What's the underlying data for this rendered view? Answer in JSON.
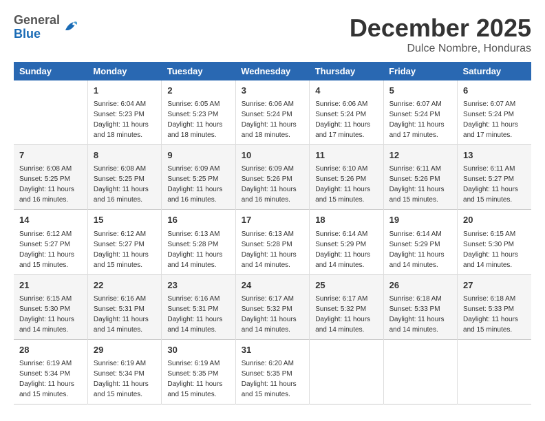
{
  "header": {
    "logo": {
      "general": "General",
      "blue": "Blue"
    },
    "title": "December 2025",
    "location": "Dulce Nombre, Honduras"
  },
  "days_of_week": [
    "Sunday",
    "Monday",
    "Tuesday",
    "Wednesday",
    "Thursday",
    "Friday",
    "Saturday"
  ],
  "weeks": [
    [
      {
        "day": "",
        "info": ""
      },
      {
        "day": "1",
        "info": "Sunrise: 6:04 AM\nSunset: 5:23 PM\nDaylight: 11 hours\nand 18 minutes."
      },
      {
        "day": "2",
        "info": "Sunrise: 6:05 AM\nSunset: 5:23 PM\nDaylight: 11 hours\nand 18 minutes."
      },
      {
        "day": "3",
        "info": "Sunrise: 6:06 AM\nSunset: 5:24 PM\nDaylight: 11 hours\nand 18 minutes."
      },
      {
        "day": "4",
        "info": "Sunrise: 6:06 AM\nSunset: 5:24 PM\nDaylight: 11 hours\nand 17 minutes."
      },
      {
        "day": "5",
        "info": "Sunrise: 6:07 AM\nSunset: 5:24 PM\nDaylight: 11 hours\nand 17 minutes."
      },
      {
        "day": "6",
        "info": "Sunrise: 6:07 AM\nSunset: 5:24 PM\nDaylight: 11 hours\nand 17 minutes."
      }
    ],
    [
      {
        "day": "7",
        "info": "Sunrise: 6:08 AM\nSunset: 5:25 PM\nDaylight: 11 hours\nand 16 minutes."
      },
      {
        "day": "8",
        "info": "Sunrise: 6:08 AM\nSunset: 5:25 PM\nDaylight: 11 hours\nand 16 minutes."
      },
      {
        "day": "9",
        "info": "Sunrise: 6:09 AM\nSunset: 5:25 PM\nDaylight: 11 hours\nand 16 minutes."
      },
      {
        "day": "10",
        "info": "Sunrise: 6:09 AM\nSunset: 5:26 PM\nDaylight: 11 hours\nand 16 minutes."
      },
      {
        "day": "11",
        "info": "Sunrise: 6:10 AM\nSunset: 5:26 PM\nDaylight: 11 hours\nand 15 minutes."
      },
      {
        "day": "12",
        "info": "Sunrise: 6:11 AM\nSunset: 5:26 PM\nDaylight: 11 hours\nand 15 minutes."
      },
      {
        "day": "13",
        "info": "Sunrise: 6:11 AM\nSunset: 5:27 PM\nDaylight: 11 hours\nand 15 minutes."
      }
    ],
    [
      {
        "day": "14",
        "info": "Sunrise: 6:12 AM\nSunset: 5:27 PM\nDaylight: 11 hours\nand 15 minutes."
      },
      {
        "day": "15",
        "info": "Sunrise: 6:12 AM\nSunset: 5:27 PM\nDaylight: 11 hours\nand 15 minutes."
      },
      {
        "day": "16",
        "info": "Sunrise: 6:13 AM\nSunset: 5:28 PM\nDaylight: 11 hours\nand 14 minutes."
      },
      {
        "day": "17",
        "info": "Sunrise: 6:13 AM\nSunset: 5:28 PM\nDaylight: 11 hours\nand 14 minutes."
      },
      {
        "day": "18",
        "info": "Sunrise: 6:14 AM\nSunset: 5:29 PM\nDaylight: 11 hours\nand 14 minutes."
      },
      {
        "day": "19",
        "info": "Sunrise: 6:14 AM\nSunset: 5:29 PM\nDaylight: 11 hours\nand 14 minutes."
      },
      {
        "day": "20",
        "info": "Sunrise: 6:15 AM\nSunset: 5:30 PM\nDaylight: 11 hours\nand 14 minutes."
      }
    ],
    [
      {
        "day": "21",
        "info": "Sunrise: 6:15 AM\nSunset: 5:30 PM\nDaylight: 11 hours\nand 14 minutes."
      },
      {
        "day": "22",
        "info": "Sunrise: 6:16 AM\nSunset: 5:31 PM\nDaylight: 11 hours\nand 14 minutes."
      },
      {
        "day": "23",
        "info": "Sunrise: 6:16 AM\nSunset: 5:31 PM\nDaylight: 11 hours\nand 14 minutes."
      },
      {
        "day": "24",
        "info": "Sunrise: 6:17 AM\nSunset: 5:32 PM\nDaylight: 11 hours\nand 14 minutes."
      },
      {
        "day": "25",
        "info": "Sunrise: 6:17 AM\nSunset: 5:32 PM\nDaylight: 11 hours\nand 14 minutes."
      },
      {
        "day": "26",
        "info": "Sunrise: 6:18 AM\nSunset: 5:33 PM\nDaylight: 11 hours\nand 14 minutes."
      },
      {
        "day": "27",
        "info": "Sunrise: 6:18 AM\nSunset: 5:33 PM\nDaylight: 11 hours\nand 15 minutes."
      }
    ],
    [
      {
        "day": "28",
        "info": "Sunrise: 6:19 AM\nSunset: 5:34 PM\nDaylight: 11 hours\nand 15 minutes."
      },
      {
        "day": "29",
        "info": "Sunrise: 6:19 AM\nSunset: 5:34 PM\nDaylight: 11 hours\nand 15 minutes."
      },
      {
        "day": "30",
        "info": "Sunrise: 6:19 AM\nSunset: 5:35 PM\nDaylight: 11 hours\nand 15 minutes."
      },
      {
        "day": "31",
        "info": "Sunrise: 6:20 AM\nSunset: 5:35 PM\nDaylight: 11 hours\nand 15 minutes."
      },
      {
        "day": "",
        "info": ""
      },
      {
        "day": "",
        "info": ""
      },
      {
        "day": "",
        "info": ""
      }
    ]
  ]
}
